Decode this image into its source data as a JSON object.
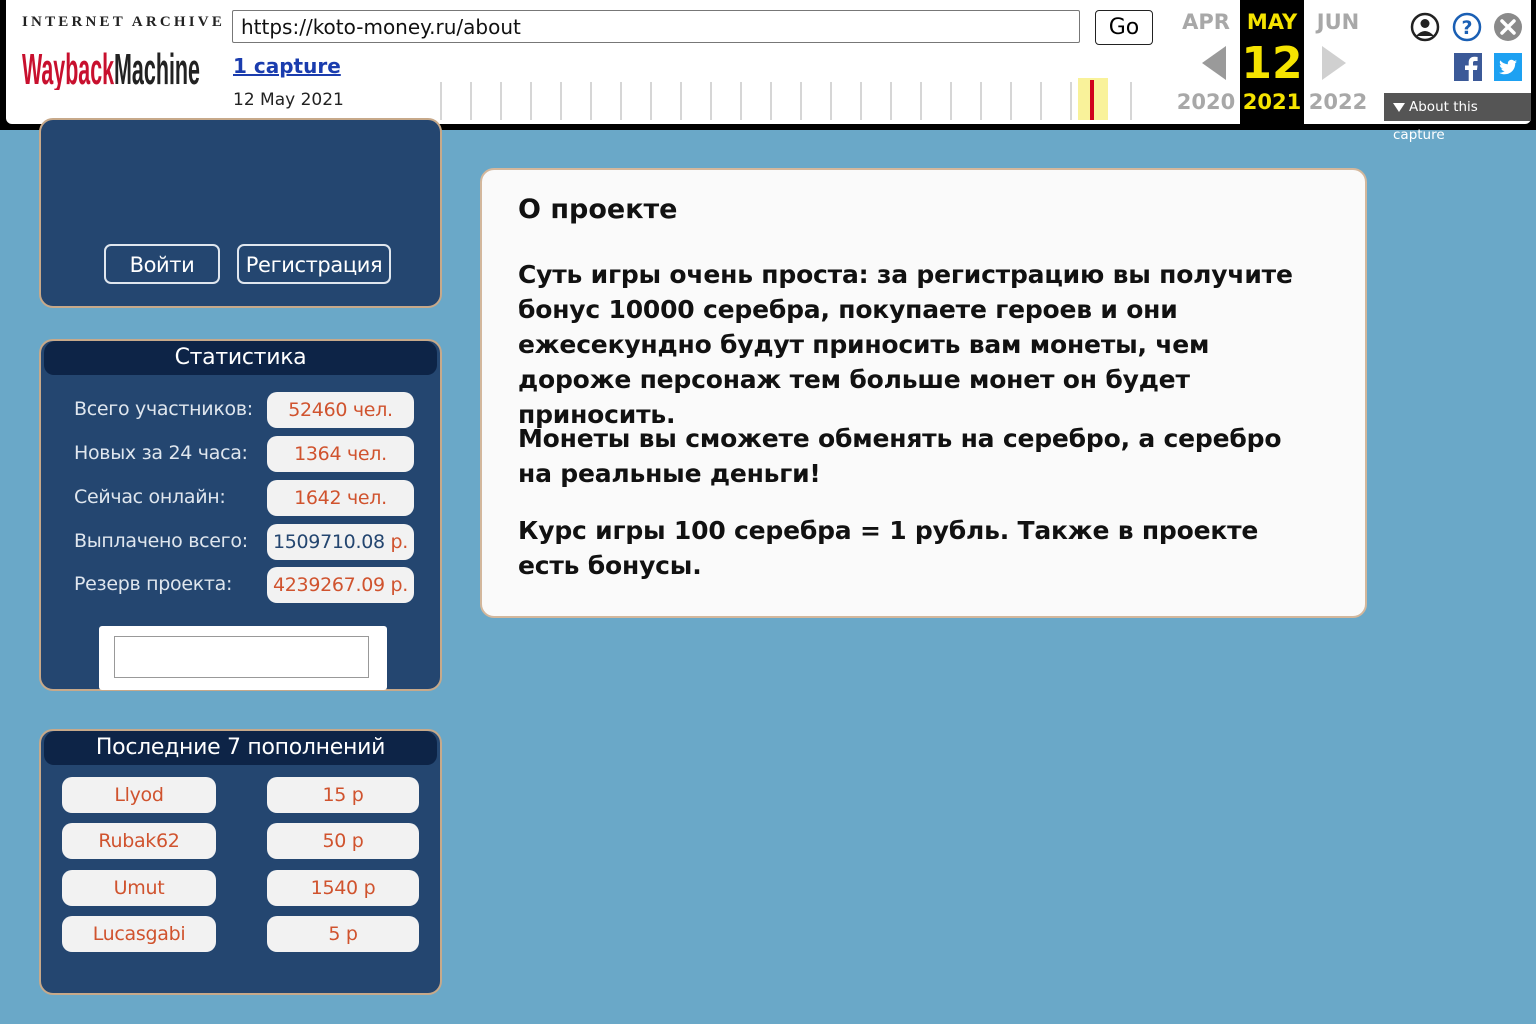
{
  "wayback": {
    "ia_label": "INTERNET ARCHIVE",
    "logo_text": "WaybackMachine",
    "url": "https://koto-money.ru/about",
    "go_label": "Go",
    "captures_link": "1 capture",
    "capture_date": "12 May 2021",
    "prev_month": "APR",
    "current_month": "MAY",
    "next_month": "JUN",
    "current_day": "12",
    "prev_year": "2020",
    "current_year": "2021",
    "next_year": "2022",
    "about_capture": "About this capture",
    "colors": {
      "highlight": "#f5e300",
      "timeline_marker": "#d0021b",
      "link": "#1a3cae"
    }
  },
  "auth": {
    "login_label": "Войти",
    "register_label": "Регистрация"
  },
  "stats": {
    "title": "Статистика",
    "rows": [
      {
        "label": "Всего участников:",
        "value": "52460 чел."
      },
      {
        "label": "Новых за 24 часа:",
        "value": "1364 чел."
      },
      {
        "label": "Сейчас онлайн:",
        "value": "1642 чел."
      },
      {
        "label": "Выплачено всего:",
        "value_num": "1509710.08",
        "value_unit": "р."
      },
      {
        "label": "Резерв проекта:",
        "value": "4239267.09 р."
      }
    ]
  },
  "deposits": {
    "title": "Последние 7 пополнений",
    "rows": [
      {
        "user": "Llyod",
        "amount": "15 р"
      },
      {
        "user": "Rubak62",
        "amount": "50 р"
      },
      {
        "user": "Umut",
        "amount": "1540 р"
      },
      {
        "user": "Lucasgabi",
        "amount": "5 р"
      }
    ]
  },
  "about": {
    "title": "О проекте",
    "paragraphs": [
      "Суть игры очень проста: за регистрацию вы получите бонус 10000 серебра, покупаете героев и они ежесекундно будут приносить вам монеты, чем дороже персонаж тем больше монет он будет приносить.",
      "Монеты вы сможете обменять на серебро, а серебро на реальные деньги!",
      "Курс игры 100 серебра = 1 рубль. Также в проекте есть бонусы."
    ]
  },
  "colors": {
    "page_bg": "#6aa8c8",
    "panel_bg": "#244670",
    "panel_title_bg": "#0d2447",
    "pill_text": "#d0532e"
  }
}
